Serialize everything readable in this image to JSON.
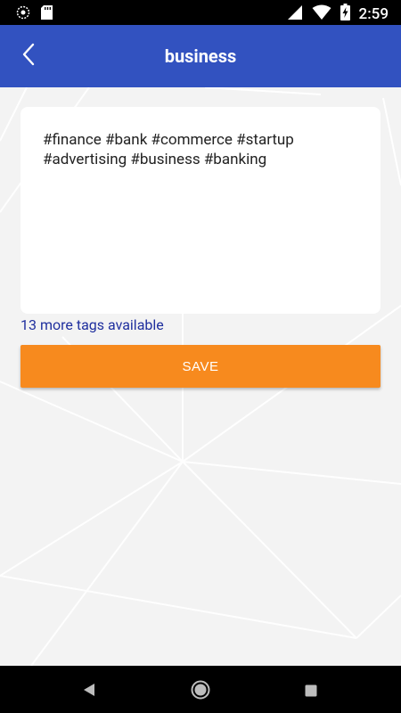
{
  "status_bar": {
    "time": "2:59",
    "left_icons": [
      "settings-sync-icon",
      "sd-card-icon"
    ],
    "right_icons": [
      "signal-icon",
      "wifi-icon",
      "battery-charging-icon"
    ]
  },
  "app_bar": {
    "title": "business",
    "back_icon": "chevron-left-icon",
    "color": "#3252c0"
  },
  "tags_card": {
    "text": "#finance #bank #commerce #startup\n#advertising #business #banking"
  },
  "more_tags_label": "13 more tags available",
  "save_button": {
    "label": "SAVE",
    "color": "#f78a1e"
  },
  "nav_bar": {
    "items": [
      "back-triangle-icon",
      "home-circle-icon",
      "recents-square-icon"
    ]
  }
}
